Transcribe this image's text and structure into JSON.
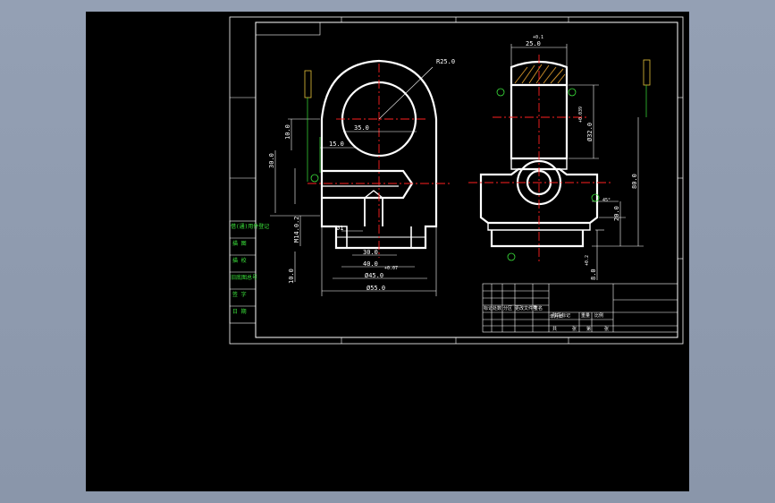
{
  "colors": {
    "background": "#8d99ad",
    "paper": "#000000",
    "outline": "#ffffff",
    "centerline": "#ff2020",
    "annotation": "#3ce63c",
    "tag": "#e8c23a",
    "hatch": "#c58a28"
  },
  "left_view": {
    "dim_R25": "R25.0",
    "dim_35": "35.0",
    "dim_15": "15.0",
    "dim_10": "10.0",
    "dim_30": "30.0",
    "dim_dia_small": "Ø1",
    "dim_thread": "M14.0.2",
    "dim_30_bot": "30.0",
    "dim_40": "40.0",
    "dim_45": "Ø45.0",
    "dim_55": "Ø55.0",
    "dim_10_left": "10.0",
    "dim_tol_small": "+0.07"
  },
  "right_view": {
    "dim_25_top": "25.0",
    "dim_tol_top": "+0.1",
    "dim_dia_32": "Ø32.0",
    "dim_tol_32": "+0.039",
    "dim_80": "80.0",
    "dim_20": "20.0",
    "dim_8": "8.0",
    "dim_tol_8": "+0.2",
    "dim_angle": "45°"
  },
  "left_table": {
    "rows": [
      "借(通)用件登记",
      "描  图",
      "描  校",
      "旧底图总号",
      "签  字",
      "日  期"
    ]
  },
  "title_block": {
    "row1": [
      "",
      "",
      "",
      "",
      "",
      ""
    ],
    "labels": [
      "标记",
      "处数",
      "分区",
      "更改文件号",
      "签名",
      "年月日"
    ],
    "stage": [
      "阶段标记",
      "重量",
      "比例"
    ],
    "bottom": [
      "共",
      "张",
      "第",
      "张"
    ]
  }
}
